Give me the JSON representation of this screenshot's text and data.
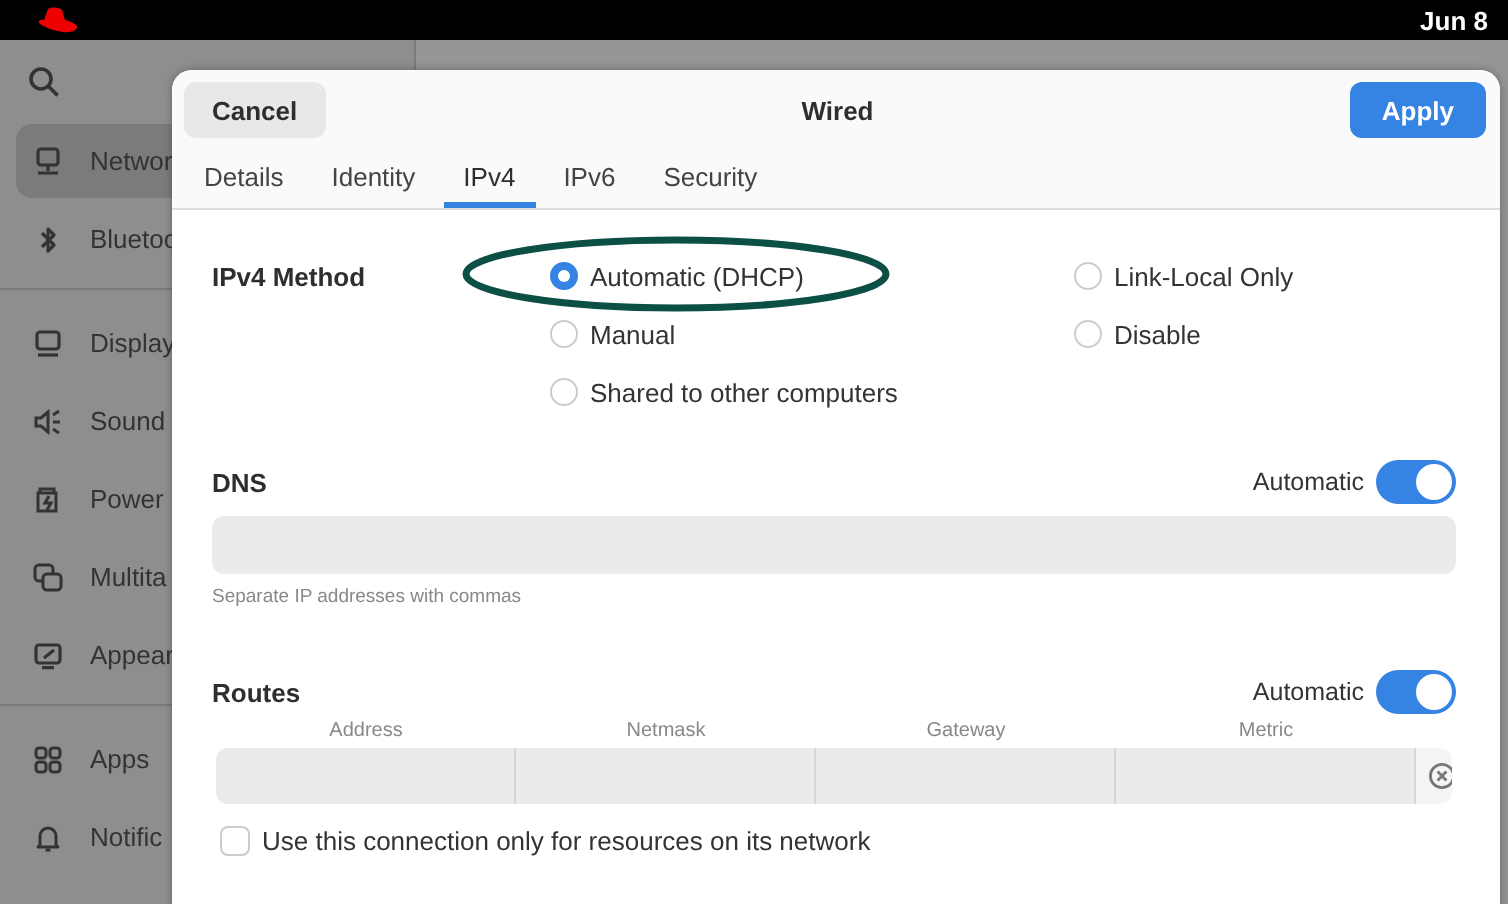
{
  "top_bar": {
    "clock": "Jun 8"
  },
  "settings": {
    "groups": [
      [
        {
          "label": "Networ",
          "selected": true
        },
        {
          "label": "Bluetoo",
          "selected": false
        }
      ],
      [
        {
          "label": "Display",
          "selected": false
        },
        {
          "label": "Sound",
          "selected": false
        },
        {
          "label": "Power",
          "selected": false
        },
        {
          "label": "Multita",
          "selected": false
        },
        {
          "label": "Appear",
          "selected": false
        }
      ],
      [
        {
          "label": "Apps",
          "selected": false
        },
        {
          "label": "Notific",
          "selected": false
        }
      ]
    ]
  },
  "dialog": {
    "title": "Wired",
    "cancel": "Cancel",
    "apply": "Apply",
    "tabs": [
      {
        "label": "Details",
        "selected": false
      },
      {
        "label": "Identity",
        "selected": false
      },
      {
        "label": "IPv4",
        "selected": true
      },
      {
        "label": "IPv6",
        "selected": false
      },
      {
        "label": "Security",
        "selected": false
      }
    ],
    "ipv4_method": {
      "label": "IPv4 Method",
      "columns": [
        [
          {
            "label": "Automatic (DHCP)",
            "selected": true
          },
          {
            "label": "Manual",
            "selected": false
          },
          {
            "label": "Shared to other computers",
            "selected": false
          }
        ],
        [
          {
            "label": "Link-Local Only",
            "selected": false
          },
          {
            "label": "Disable",
            "selected": false
          }
        ]
      ]
    },
    "dns": {
      "label": "DNS",
      "automatic_label": "Automatic",
      "automatic": true,
      "hint": "Separate IP addresses with commas"
    },
    "routes": {
      "label": "Routes",
      "automatic_label": "Automatic",
      "automatic": true,
      "columns": [
        "Address",
        "Netmask",
        "Gateway",
        "Metric"
      ]
    },
    "only_local": {
      "label": "Use this connection only for resources on its network",
      "checked": false
    }
  }
}
